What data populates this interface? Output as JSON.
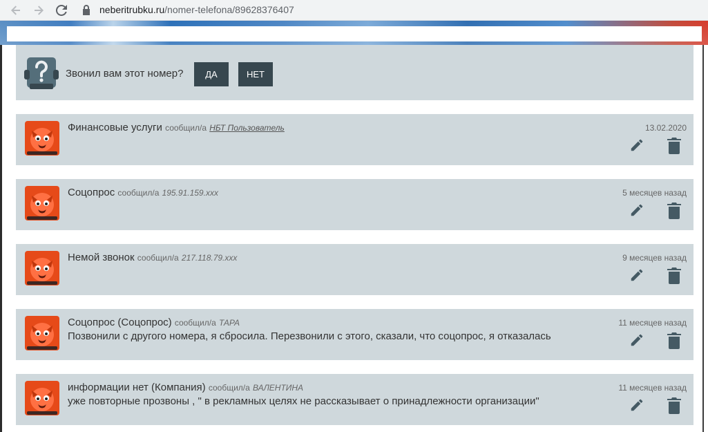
{
  "browser": {
    "url_host": "neberitrubku.ru",
    "url_path": "/nomer-telefona/89628376407"
  },
  "question": {
    "text": "Звонил вам этот номер?",
    "yes_label": "ДА",
    "no_label": "НЕТ"
  },
  "reports": [
    {
      "title": "Финансовые услуги",
      "reported_label": "сообщил/а",
      "author": "НБТ Пользователь",
      "author_is_link": true,
      "body": "",
      "date": "13.02.2020"
    },
    {
      "title": "Соцопрос",
      "reported_label": "сообщил/а",
      "author": "195.91.159.xxx",
      "author_is_link": false,
      "body": "",
      "date": "5 месяцев назад"
    },
    {
      "title": "Немой звонок",
      "reported_label": "сообщил/а",
      "author": "217.118.79.xxx",
      "author_is_link": false,
      "body": "",
      "date": "9 месяцев назад"
    },
    {
      "title": "Соцопрос (Соцопрос)",
      "reported_label": "сообщил/а",
      "author": "ТАРА",
      "author_is_link": false,
      "body": "Позвонили с другого номера, я сбросила. Перезвонили с этого, сказали, что соцопрос, я отказалась",
      "date": "11 месяцев назад"
    },
    {
      "title": "информации нет (Компания)",
      "reported_label": "сообщил/а",
      "author": "ВАЛЕНТИНА",
      "author_is_link": false,
      "body": "уже повторные прозвоны , \" в рекламных целях не рассказывает о принадлежности организации\"",
      "date": "11 месяцев назад"
    }
  ],
  "colors": {
    "panel_bg": "#cfd8dc",
    "button_bg": "#37474f",
    "icon_color": "#455a64"
  }
}
